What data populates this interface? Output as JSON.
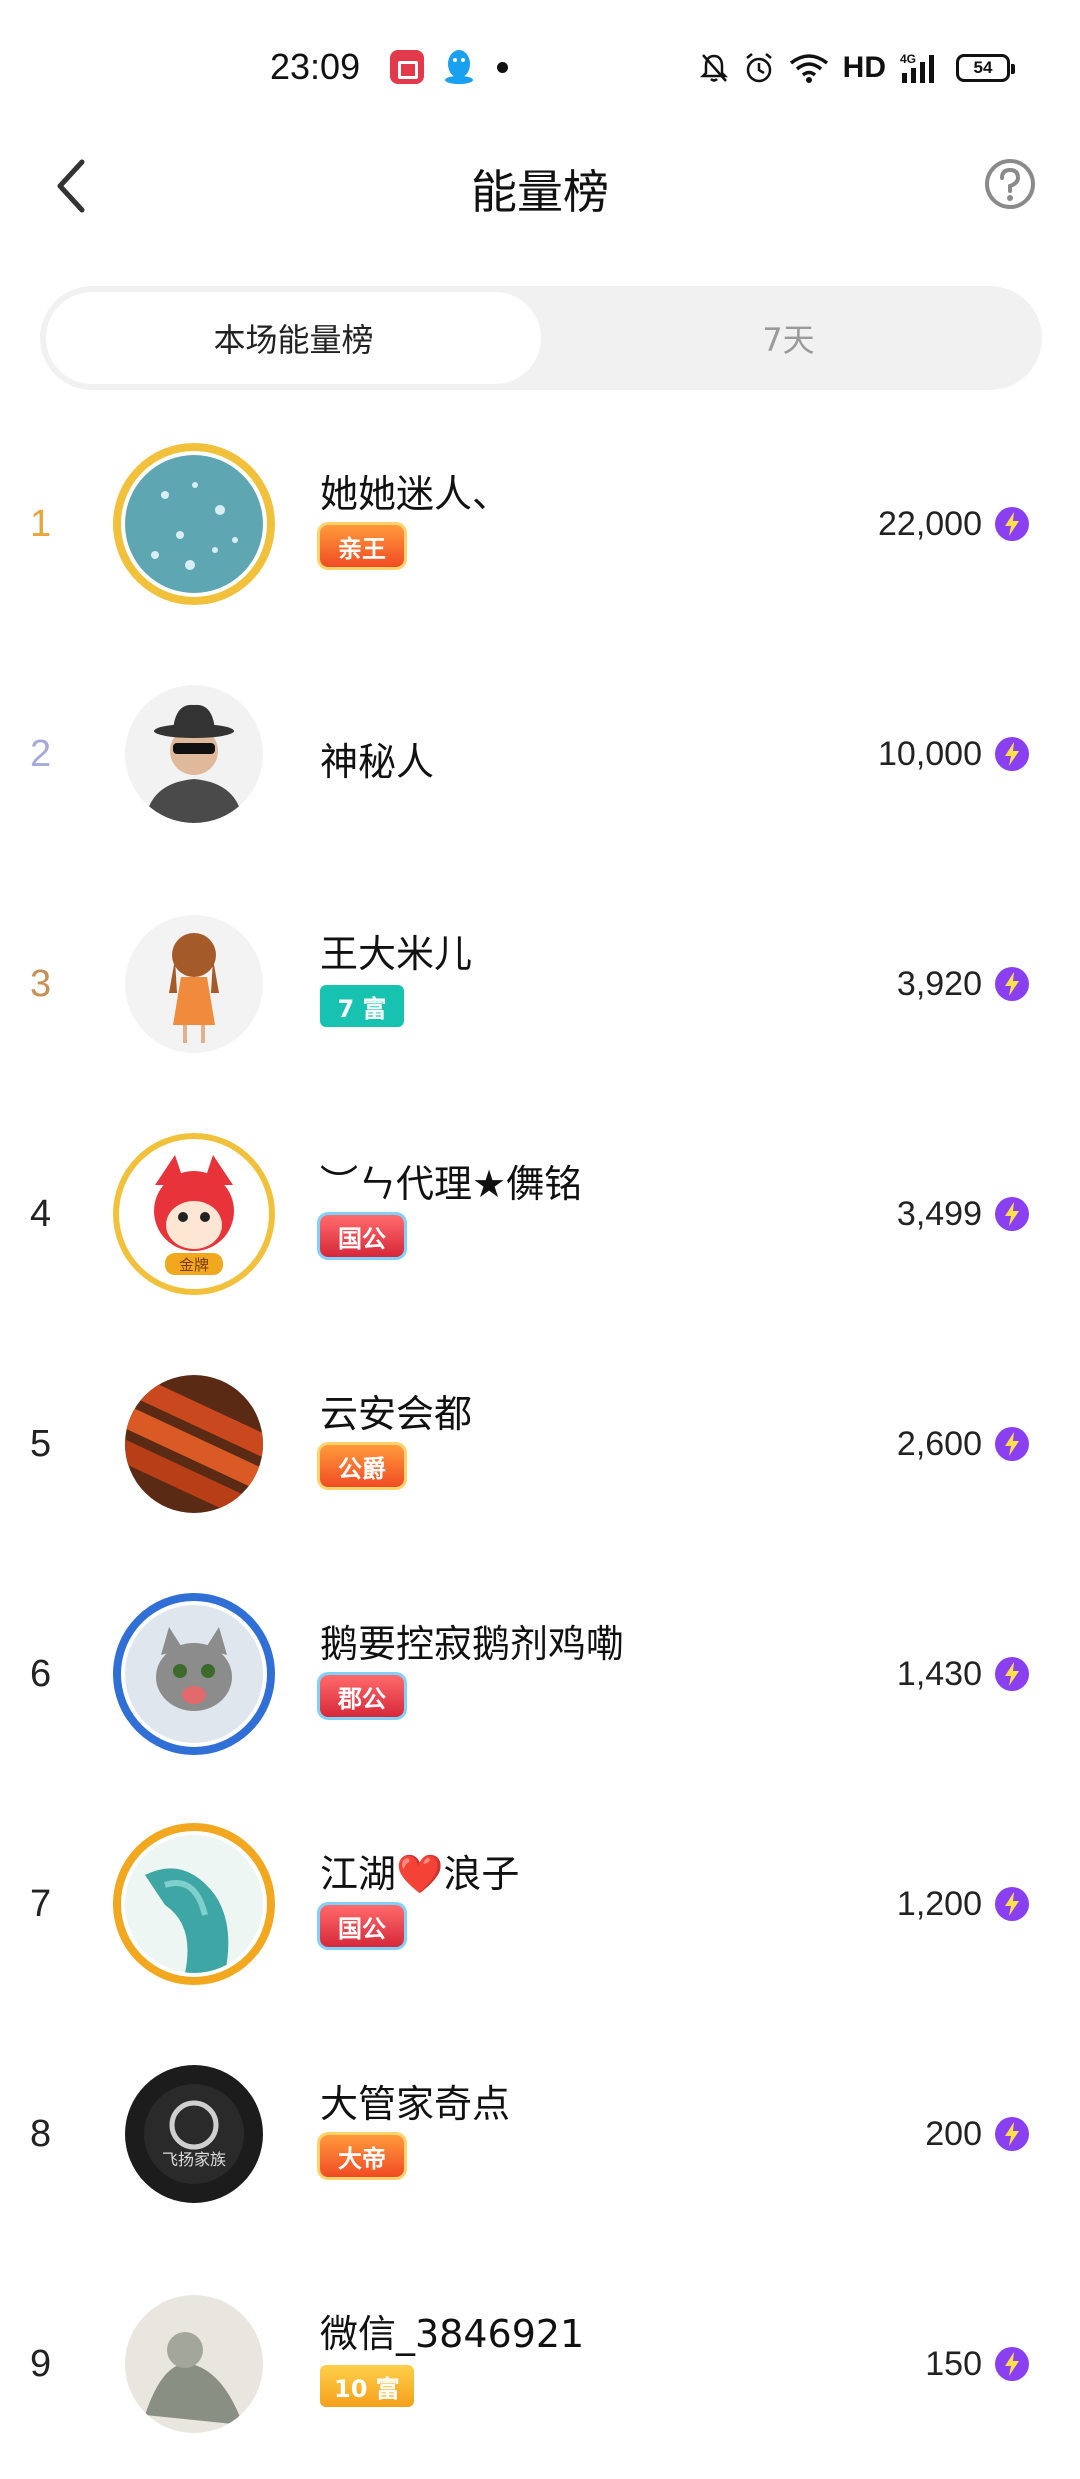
{
  "status_bar": {
    "time": "23:09",
    "network": "HD",
    "signal_label": "4G",
    "battery": "54"
  },
  "nav": {
    "title": "能量榜"
  },
  "tabs": [
    {
      "label": "本场能量榜",
      "active": true
    },
    {
      "label": "7天",
      "active": false
    }
  ],
  "rankings": [
    {
      "rank": "1",
      "name": "她她迷人、",
      "badge": "亲王",
      "energy": "22,000"
    },
    {
      "rank": "2",
      "name": "神秘人",
      "badge": "",
      "energy": "10,000"
    },
    {
      "rank": "3",
      "name": "王大米儿",
      "badge": "7 富",
      "energy": "3,920"
    },
    {
      "rank": "4",
      "name": "︶ㄣ代理★儛铭",
      "badge": "国公",
      "energy": "3,499"
    },
    {
      "rank": "5",
      "name": "云安会都",
      "badge": "公爵",
      "energy": "2,600"
    },
    {
      "rank": "6",
      "name": "鹅要控寂鹅剂鸡嘞",
      "badge": "郡公",
      "energy": "1,430"
    },
    {
      "rank": "7",
      "name": "江湖❤️浪子",
      "badge": "国公",
      "energy": "1,200"
    },
    {
      "rank": "8",
      "name": "大管家奇点",
      "badge": "大帝",
      "energy": "200"
    },
    {
      "rank": "9",
      "name": "微信_3846921",
      "badge": "10 富",
      "energy": "150"
    }
  ],
  "avatar_labels": {
    "r4": "金牌",
    "r8": "飞扬家族"
  },
  "colors": {
    "rank1": "#e8a53a",
    "rank2": "#a4a9d8",
    "rank3": "#c98e53",
    "energy_icon": "#8a3ff0"
  }
}
